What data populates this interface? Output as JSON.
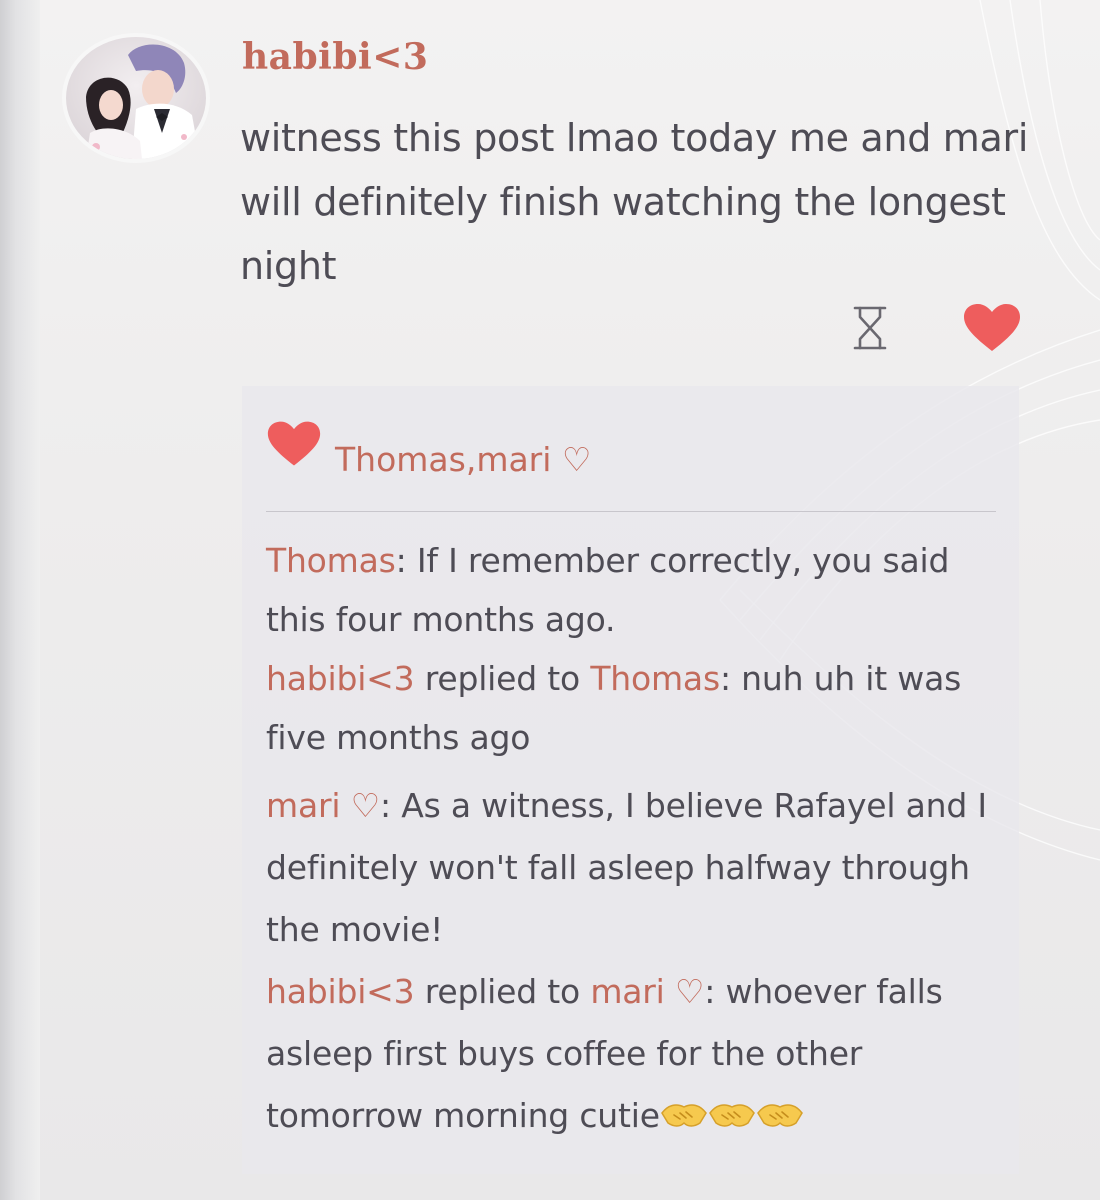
{
  "post": {
    "author": "habibi<3",
    "text": "witness this post lmao today me and mari will definitely finish watching the longest night"
  },
  "actions": {
    "hourglass_icon": "hourglass-icon",
    "like_icon": "heart-icon"
  },
  "likes": {
    "names": "Thomas,mari ♡"
  },
  "comments": [
    {
      "author": "Thomas",
      "separator": ": ",
      "text": "If I remember correctly, you said this four months ago."
    },
    {
      "author": "habibi<3",
      "reply_word": " replied to ",
      "reply_to": "Thomas",
      "separator": ": ",
      "text": "nuh uh it was five months ago"
    },
    {
      "author": "mari ♡",
      "separator": ": ",
      "text": "As a witness, I believe Rafayel and I definitely won't fall asleep halfway through the movie!"
    },
    {
      "author": "habibi<3",
      "reply_word": " replied to ",
      "reply_to": "mari ♡",
      "separator": ": ",
      "text": "whoever falls asleep first buys coffee for the other tomorrow morning cutie",
      "emoji_icons": [
        "handshake-icon",
        "handshake-icon",
        "handshake-icon"
      ]
    }
  ],
  "colors": {
    "accent": "#c26b5c",
    "heart": "#ee5d5d",
    "text": "#4e4c55"
  }
}
